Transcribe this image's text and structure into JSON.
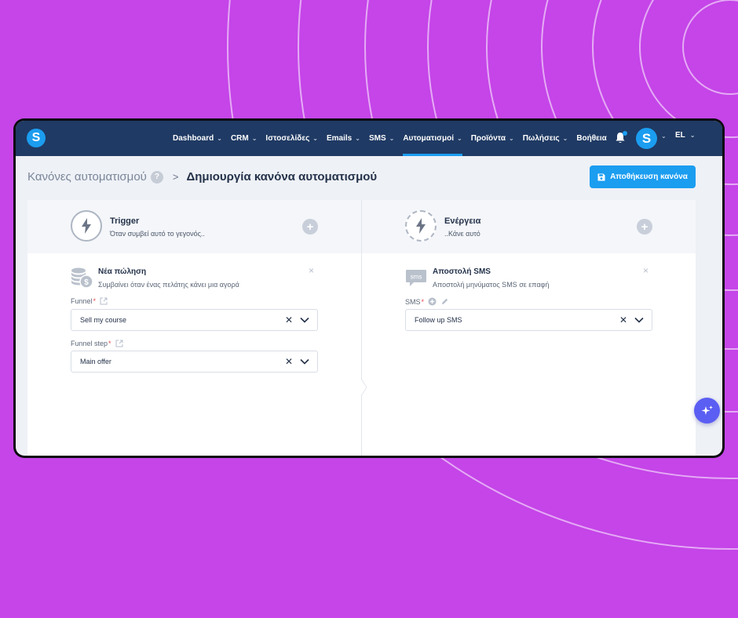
{
  "nav": {
    "logo_letter": "S",
    "items": [
      {
        "label": "Dashboard",
        "has_chevron": true
      },
      {
        "label": "CRM",
        "has_chevron": true
      },
      {
        "label": "Ιστοσελίδες",
        "has_chevron": true
      },
      {
        "label": "Emails",
        "has_chevron": true
      },
      {
        "label": "SMS",
        "has_chevron": true
      },
      {
        "label": "Αυτοματισμοί",
        "has_chevron": true,
        "active": true
      },
      {
        "label": "Προϊόντα",
        "has_chevron": true
      },
      {
        "label": "Πωλήσεις",
        "has_chevron": true
      },
      {
        "label": "Βοήθεια",
        "has_chevron": false
      }
    ],
    "avatar_letter": "S",
    "language": "EL",
    "icons": [
      "bell-icon",
      "chevron-down-icon"
    ]
  },
  "header": {
    "breadcrumb_root": "Κανόνες αυτοματισμού",
    "help_badge": "?",
    "breadcrumb_sep": ">",
    "breadcrumb_current": "Δημιουργία κανόνα αυτοματισμού",
    "save_label": "Αποθήκευση κανόνα"
  },
  "trigger": {
    "title": "Trigger",
    "subtitle": "Όταν συμβεί αυτό το γεγονός..",
    "card": {
      "title": "Νέα πώληση",
      "subtitle": "Συμβαίνει όταν ένας πελάτης κάνει μια αγορά",
      "close": "×",
      "fields": [
        {
          "label": "Funnel",
          "required": true,
          "value": "Sell my course"
        },
        {
          "label": "Funnel step",
          "required": true,
          "value": "Main offer"
        }
      ]
    }
  },
  "action": {
    "title": "Ενέργεια",
    "subtitle": "..Κάνε αυτό",
    "card": {
      "title": "Αποστολή SMS",
      "subtitle": "Αποστολή μηνύματος SMS σε επαφή",
      "icon_text": "sms",
      "close": "×",
      "fields": [
        {
          "label": "SMS",
          "required": true,
          "value": "Follow up SMS"
        }
      ]
    }
  },
  "common": {
    "plus": "+",
    "clear": "✕",
    "required_mark": "*"
  },
  "colors": {
    "background": "#c545e8",
    "nav_bg": "#1f3a64",
    "accent": "#1b9df0",
    "ai_button": "#5b5ef2"
  }
}
